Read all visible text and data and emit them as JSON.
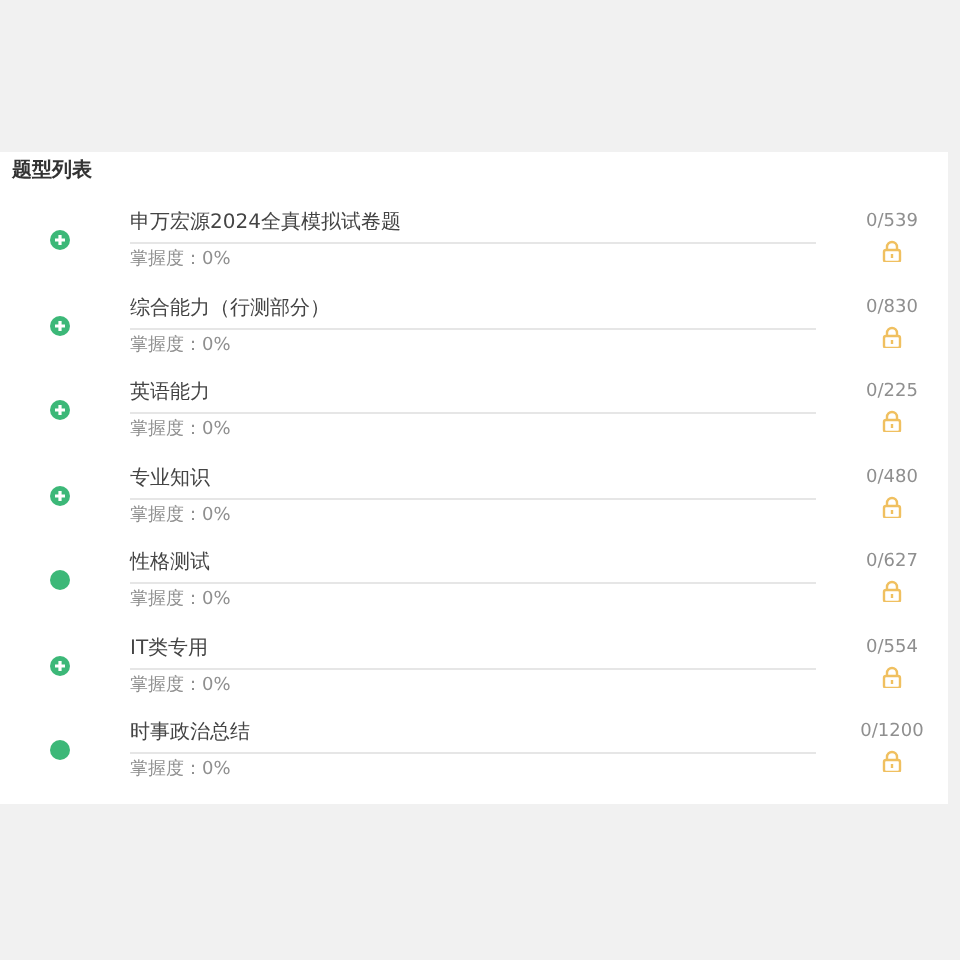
{
  "panel": {
    "title": "题型列表"
  },
  "items": [
    {
      "kind": "plus",
      "title": "申万宏源2024全真模拟试卷题",
      "mastery": "掌握度：0%",
      "count": "0/539",
      "locked": true
    },
    {
      "kind": "plus",
      "title": "综合能力（行测部分）",
      "mastery": "掌握度：0%",
      "count": "0/830",
      "locked": true
    },
    {
      "kind": "plus",
      "title": "英语能力",
      "mastery": "掌握度：0%",
      "count": "0/225",
      "locked": true
    },
    {
      "kind": "plus",
      "title": "专业知识",
      "mastery": "掌握度：0%",
      "count": "0/480",
      "locked": true
    },
    {
      "kind": "dot",
      "title": "性格测试",
      "mastery": "掌握度：0%",
      "count": "0/627",
      "locked": true
    },
    {
      "kind": "plus",
      "title": "IT类专用",
      "mastery": "掌握度：0%",
      "count": "0/554",
      "locked": true
    },
    {
      "kind": "dot",
      "title": "时事政治总结",
      "mastery": "掌握度：0%",
      "count": "0/1200",
      "locked": true
    }
  ]
}
